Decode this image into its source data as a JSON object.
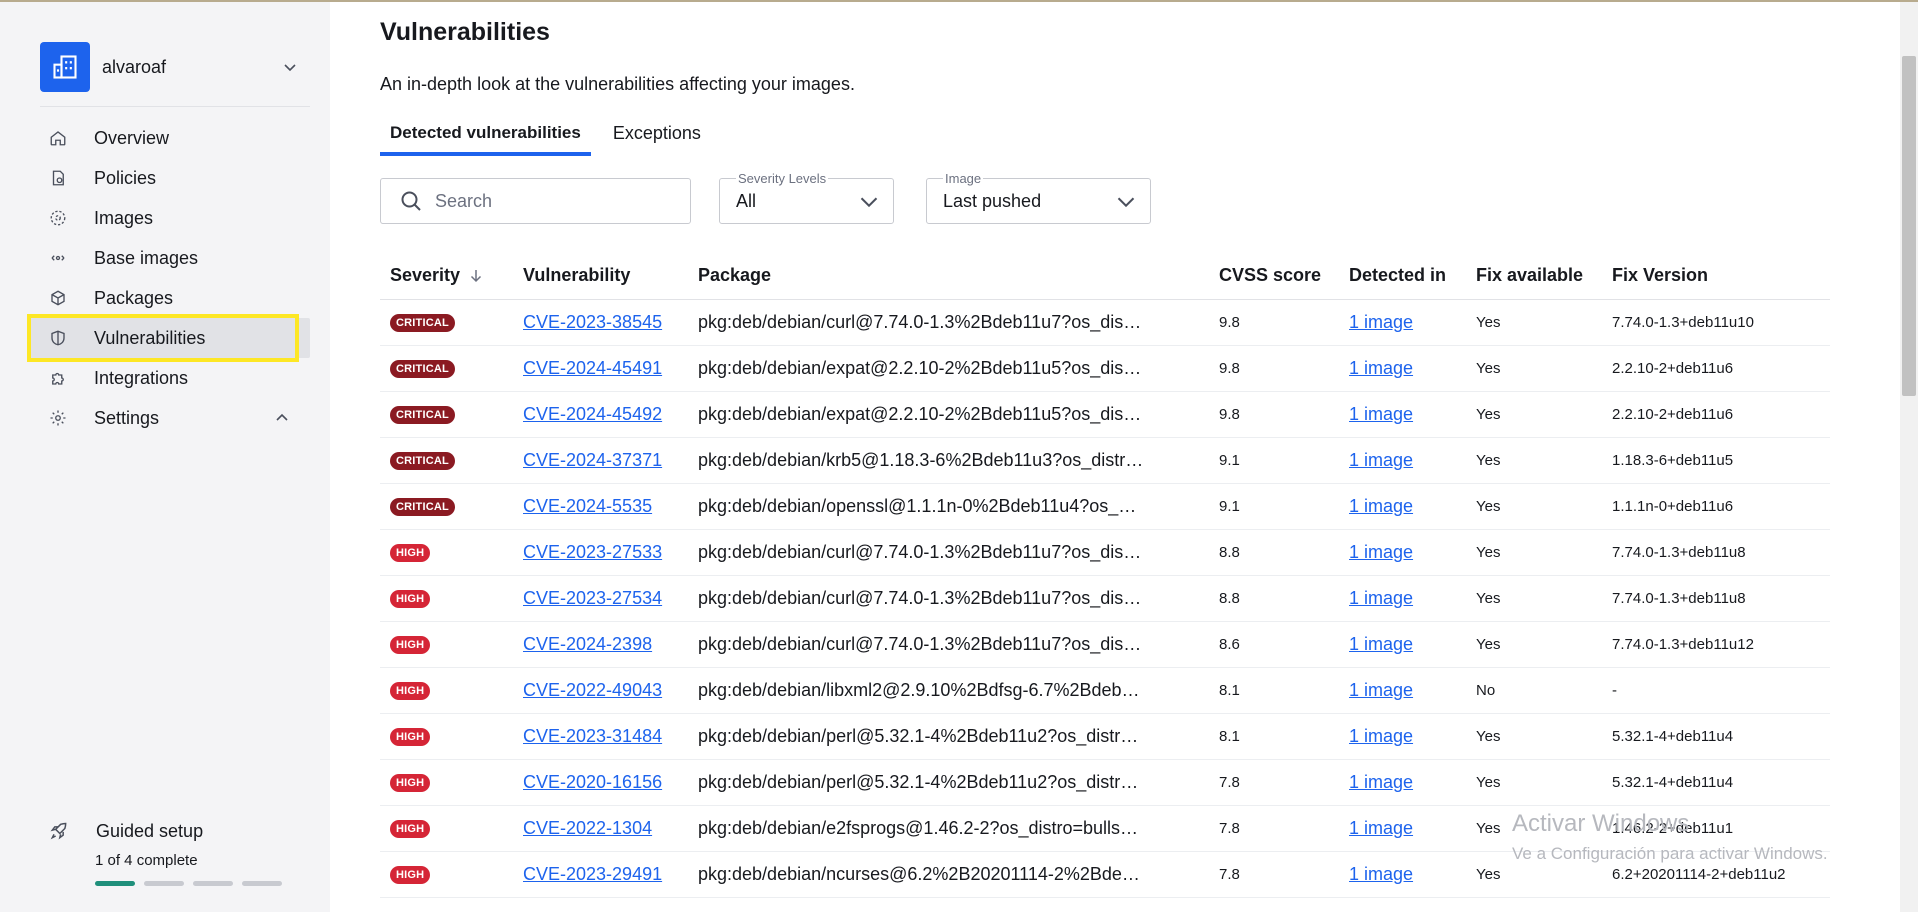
{
  "org": {
    "name": "alvaroaf"
  },
  "nav": {
    "items": [
      {
        "label": "Overview",
        "icon": "home-icon"
      },
      {
        "label": "Policies",
        "icon": "policy-icon"
      },
      {
        "label": "Images",
        "icon": "images-icon"
      },
      {
        "label": "Base images",
        "icon": "base-images-icon"
      },
      {
        "label": "Packages",
        "icon": "package-icon"
      },
      {
        "label": "Vulnerabilities",
        "icon": "shield-icon",
        "active": true
      },
      {
        "label": "Integrations",
        "icon": "puzzle-icon"
      },
      {
        "label": "Settings",
        "icon": "gear-icon"
      }
    ]
  },
  "guided": {
    "title": "Guided setup",
    "progress_text": "1 of 4 complete",
    "completed": 1,
    "total": 4
  },
  "page": {
    "title": "Vulnerabilities",
    "description": "An in-depth look at the vulnerabilities affecting your images."
  },
  "tabs": [
    {
      "label": "Detected vulnerabilities",
      "active": true
    },
    {
      "label": "Exceptions",
      "active": false
    }
  ],
  "filters": {
    "search_placeholder": "Search",
    "severity": {
      "label": "Severity Levels",
      "value": "All"
    },
    "image": {
      "label": "Image",
      "value": "Last pushed"
    }
  },
  "table": {
    "headers": [
      "Severity",
      "Vulnerability",
      "Package",
      "CVSS score",
      "Detected in",
      "Fix available",
      "Fix Version"
    ],
    "rows": [
      {
        "severity": "CRITICAL",
        "cve": "CVE-2023-38545",
        "package": "pkg:deb/debian/curl@7.74.0-1.3%2Bdeb11u7?os_dis…",
        "cvss": "9.8",
        "detected": "1 image",
        "fix": "Yes",
        "fix_version": "7.74.0-1.3+deb11u10"
      },
      {
        "severity": "CRITICAL",
        "cve": "CVE-2024-45491",
        "package": "pkg:deb/debian/expat@2.2.10-2%2Bdeb11u5?os_dis…",
        "cvss": "9.8",
        "detected": "1 image",
        "fix": "Yes",
        "fix_version": "2.2.10-2+deb11u6"
      },
      {
        "severity": "CRITICAL",
        "cve": "CVE-2024-45492",
        "package": "pkg:deb/debian/expat@2.2.10-2%2Bdeb11u5?os_dis…",
        "cvss": "9.8",
        "detected": "1 image",
        "fix": "Yes",
        "fix_version": "2.2.10-2+deb11u6"
      },
      {
        "severity": "CRITICAL",
        "cve": "CVE-2024-37371",
        "package": "pkg:deb/debian/krb5@1.18.3-6%2Bdeb11u3?os_distr…",
        "cvss": "9.1",
        "detected": "1 image",
        "fix": "Yes",
        "fix_version": "1.18.3-6+deb11u5"
      },
      {
        "severity": "CRITICAL",
        "cve": "CVE-2024-5535",
        "package": "pkg:deb/debian/openssl@1.1.1n-0%2Bdeb11u4?os_…",
        "cvss": "9.1",
        "detected": "1 image",
        "fix": "Yes",
        "fix_version": "1.1.1n-0+deb11u6"
      },
      {
        "severity": "HIGH",
        "cve": "CVE-2023-27533",
        "package": "pkg:deb/debian/curl@7.74.0-1.3%2Bdeb11u7?os_dis…",
        "cvss": "8.8",
        "detected": "1 image",
        "fix": "Yes",
        "fix_version": "7.74.0-1.3+deb11u8"
      },
      {
        "severity": "HIGH",
        "cve": "CVE-2023-27534",
        "package": "pkg:deb/debian/curl@7.74.0-1.3%2Bdeb11u7?os_dis…",
        "cvss": "8.8",
        "detected": "1 image",
        "fix": "Yes",
        "fix_version": "7.74.0-1.3+deb11u8"
      },
      {
        "severity": "HIGH",
        "cve": "CVE-2024-2398",
        "package": "pkg:deb/debian/curl@7.74.0-1.3%2Bdeb11u7?os_dis…",
        "cvss": "8.6",
        "detected": "1 image",
        "fix": "Yes",
        "fix_version": "7.74.0-1.3+deb11u12"
      },
      {
        "severity": "HIGH",
        "cve": "CVE-2022-49043",
        "package": "pkg:deb/debian/libxml2@2.9.10%2Bdfsg-6.7%2Bdeb…",
        "cvss": "8.1",
        "detected": "1 image",
        "fix": "No",
        "fix_version": "-"
      },
      {
        "severity": "HIGH",
        "cve": "CVE-2023-31484",
        "package": "pkg:deb/debian/perl@5.32.1-4%2Bdeb11u2?os_distr…",
        "cvss": "8.1",
        "detected": "1 image",
        "fix": "Yes",
        "fix_version": "5.32.1-4+deb11u4"
      },
      {
        "severity": "HIGH",
        "cve": "CVE-2020-16156",
        "package": "pkg:deb/debian/perl@5.32.1-4%2Bdeb11u2?os_distr…",
        "cvss": "7.8",
        "detected": "1 image",
        "fix": "Yes",
        "fix_version": "5.32.1-4+deb11u4"
      },
      {
        "severity": "HIGH",
        "cve": "CVE-2022-1304",
        "package": "pkg:deb/debian/e2fsprogs@1.46.2-2?os_distro=bulls…",
        "cvss": "7.8",
        "detected": "1 image",
        "fix": "Yes",
        "fix_version": "1.46.2-2+deb11u1"
      },
      {
        "severity": "HIGH",
        "cve": "CVE-2023-29491",
        "package": "pkg:deb/debian/ncurses@6.2%2B20201114-2%2Bde…",
        "cvss": "7.8",
        "detected": "1 image",
        "fix": "Yes",
        "fix_version": "6.2+20201114-2+deb11u2"
      }
    ]
  },
  "watermark": {
    "line1": "Activar Windows",
    "line2": "Ve a Configuración para activar Windows."
  },
  "colors": {
    "accent": "#1d63ed",
    "critical": "#8b1a22",
    "high": "#d52536",
    "highlight": "#fde725",
    "progress": "#1f8f7b"
  }
}
